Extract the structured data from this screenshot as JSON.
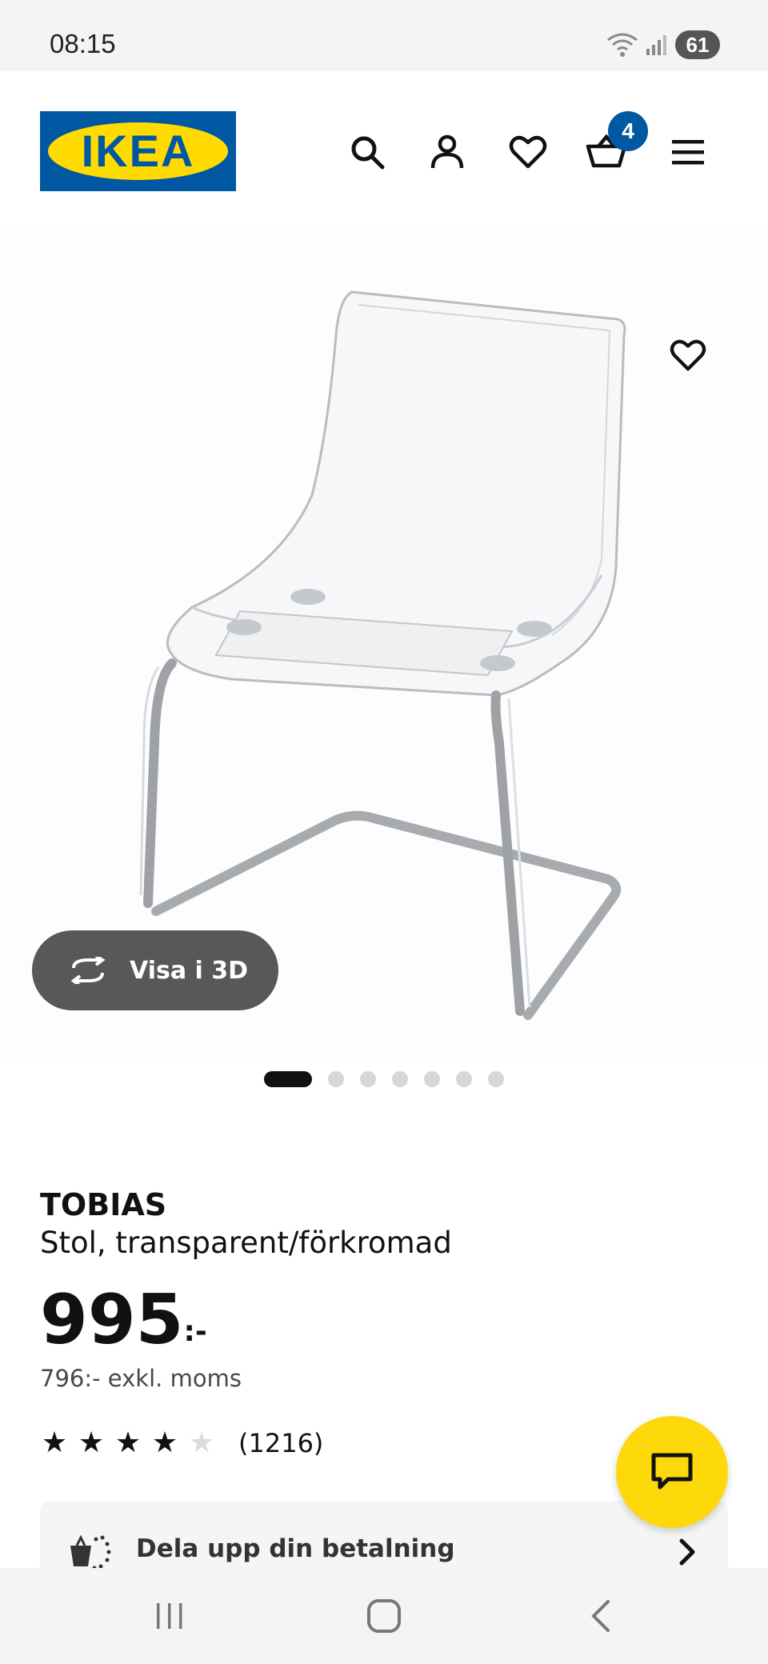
{
  "status_bar": {
    "time": "08:15",
    "battery": "61"
  },
  "header": {
    "logo_text": "IKEA",
    "cart_count": "4",
    "icons": [
      "search-icon",
      "account-icon",
      "wishlist-icon",
      "cart-icon",
      "menu-icon"
    ]
  },
  "gallery": {
    "view_3d_label": "Visa i 3D",
    "image_count": 7,
    "active_index": 0
  },
  "product": {
    "name": "TOBIAS",
    "description": "Stol, transparent/förkromad",
    "price": "995",
    "price_suffix": ":-",
    "price_excl_vat": "796:- exkl. moms",
    "rating_value": 4,
    "rating_max": 5,
    "rating_count": "(1216)"
  },
  "payment_card": {
    "label": "Dela upp din betalning"
  },
  "colors": {
    "ikea_blue": "#0058a3",
    "ikea_yellow": "#ffdb00",
    "chat_yellow": "#fdd90b"
  }
}
